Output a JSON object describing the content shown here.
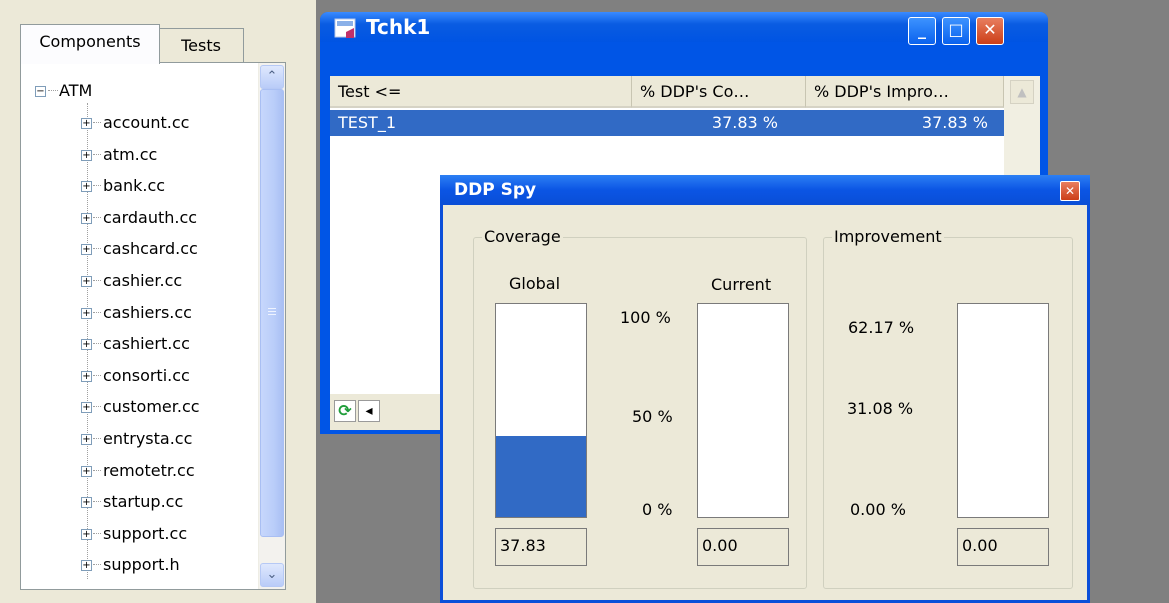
{
  "left_panel": {
    "tabs": [
      {
        "label": "Components",
        "active": true
      },
      {
        "label": "Tests",
        "active": false
      }
    ],
    "tree": {
      "root": {
        "label": "ATM",
        "expanded": true,
        "toggle": "−"
      },
      "items": [
        {
          "label": "account.cc",
          "toggle": "+"
        },
        {
          "label": "atm.cc",
          "toggle": "+"
        },
        {
          "label": "bank.cc",
          "toggle": "+"
        },
        {
          "label": "cardauth.cc",
          "toggle": "+"
        },
        {
          "label": "cashcard.cc",
          "toggle": "+"
        },
        {
          "label": "cashier.cc",
          "toggle": "+"
        },
        {
          "label": "cashiers.cc",
          "toggle": "+"
        },
        {
          "label": "cashiert.cc",
          "toggle": "+"
        },
        {
          "label": "consorti.cc",
          "toggle": "+"
        },
        {
          "label": "customer.cc",
          "toggle": "+"
        },
        {
          "label": "entrysta.cc",
          "toggle": "+"
        },
        {
          "label": "remotetr.cc",
          "toggle": "+"
        },
        {
          "label": "startup.cc",
          "toggle": "+"
        },
        {
          "label": "support.cc",
          "toggle": "+"
        },
        {
          "label": "support.h",
          "toggle": "+"
        }
      ]
    },
    "scroll_up_glyph": "⌃",
    "scroll_down_glyph": "⌄"
  },
  "tchk_window": {
    "title": "Tchk1",
    "buttons": {
      "minimize": "_",
      "maximize": "□",
      "close": "✕"
    },
    "columns": [
      "Test  <=",
      "% DDP's Co…",
      "% DDP's Impro…"
    ],
    "rows": [
      {
        "test": "TEST_1",
        "coverage": "37.83 %",
        "improvement": "37.83 %",
        "selected": true
      }
    ],
    "footer": {
      "refresh_glyph": "⟳",
      "scroll_left_glyph": "◂"
    }
  },
  "ddp_spy": {
    "title": "DDP Spy",
    "close_glyph": "✕",
    "coverage": {
      "label": "Coverage",
      "global_label": "Global",
      "current_label": "Current",
      "scale": [
        "100 %",
        "50 %",
        "0 %"
      ],
      "global_fraction": 0.3783,
      "current_fraction": 0.0,
      "global_value": "37.83",
      "current_value": "0.00"
    },
    "improvement": {
      "label": "Improvement",
      "scale": [
        "62.17 %",
        "31.08 %",
        "0.00 %"
      ],
      "fraction": 0.0,
      "value": "0.00"
    },
    "colors": {
      "bar_fill": "#316ac5",
      "selection": "#316ac5"
    }
  }
}
